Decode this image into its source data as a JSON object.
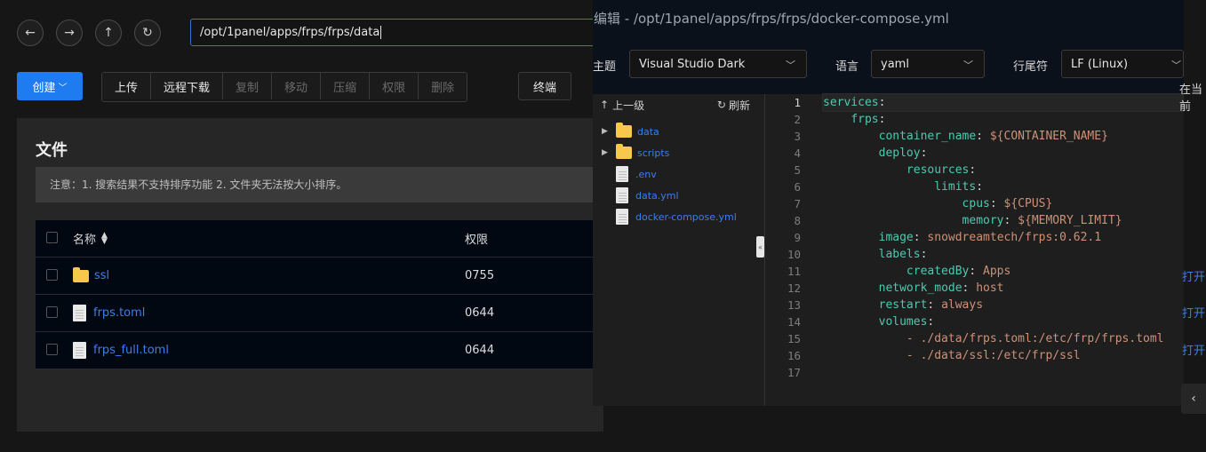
{
  "nav": {
    "back_icon": "arrow-left-icon",
    "forward_icon": "arrow-right-icon",
    "up_icon": "arrow-up-icon",
    "refresh_icon": "refresh-icon",
    "path": "/opt/1panel/apps/frps/frps/data"
  },
  "toolbar": {
    "create": "创建",
    "upload": "上传",
    "remote_download": "远程下载",
    "copy": "复制",
    "move": "移动",
    "compress": "压缩",
    "permission": "权限",
    "delete": "删除",
    "terminal": "终端"
  },
  "files": {
    "title": "文件",
    "notice": "注意：1. 搜索结果不支持排序功能 2. 文件夹无法按大小排序。",
    "columns": {
      "name": "名称",
      "perm": "权限"
    },
    "rows": [
      {
        "name": "ssl",
        "type": "folder",
        "perm": "0755"
      },
      {
        "name": "frps.toml",
        "type": "file",
        "perm": "0644"
      },
      {
        "name": "frps_full.toml",
        "type": "file",
        "perm": "0644"
      }
    ],
    "open_label": "打开"
  },
  "editor": {
    "title": "编辑 - /opt/1panel/apps/frps/frps/docker-compose.yml",
    "theme_label": "主题",
    "theme_value": "Visual Studio Dark",
    "lang_label": "语言",
    "lang_value": "yaml",
    "eol_label": "行尾符",
    "eol_value": "LF (Linux)",
    "right_cut": "在当前",
    "tree": {
      "up": "上一级",
      "refresh": "刷新",
      "items": [
        {
          "name": "data",
          "type": "folder"
        },
        {
          "name": "scripts",
          "type": "folder"
        },
        {
          "name": ".env",
          "type": "file"
        },
        {
          "name": "data.yml",
          "type": "file"
        },
        {
          "name": "docker-compose.yml",
          "type": "file"
        }
      ]
    },
    "code": [
      {
        "n": "1",
        "indent": 0,
        "key": "services",
        "val": ""
      },
      {
        "n": "2",
        "indent": 1,
        "key": "frps",
        "val": ""
      },
      {
        "n": "3",
        "indent": 2,
        "key": "container_name",
        "val": "${CONTAINER_NAME}"
      },
      {
        "n": "4",
        "indent": 2,
        "key": "deploy",
        "val": ""
      },
      {
        "n": "5",
        "indent": 3,
        "key": "resources",
        "val": ""
      },
      {
        "n": "6",
        "indent": 4,
        "key": "limits",
        "val": ""
      },
      {
        "n": "7",
        "indent": 5,
        "key": "cpus",
        "val": "${CPUS}"
      },
      {
        "n": "8",
        "indent": 5,
        "key": "memory",
        "val": "${MEMORY_LIMIT}"
      },
      {
        "n": "9",
        "indent": 2,
        "key": "image",
        "val": "snowdreamtech/frps:0.62.1"
      },
      {
        "n": "10",
        "indent": 2,
        "key": "labels",
        "val": ""
      },
      {
        "n": "11",
        "indent": 3,
        "key": "createdBy",
        "val": "Apps"
      },
      {
        "n": "12",
        "indent": 2,
        "key": "network_mode",
        "val": "host"
      },
      {
        "n": "13",
        "indent": 2,
        "key": "restart",
        "val": "always"
      },
      {
        "n": "14",
        "indent": 2,
        "key": "volumes",
        "val": ""
      },
      {
        "n": "15",
        "indent": 3,
        "key": "",
        "val": "- ./data/frps.toml:/etc/frp/frps.toml"
      },
      {
        "n": "16",
        "indent": 3,
        "key": "",
        "val": "- ./data/ssl:/etc/frp/ssl"
      },
      {
        "n": "17",
        "indent": 0,
        "key": "",
        "val": ""
      }
    ]
  }
}
